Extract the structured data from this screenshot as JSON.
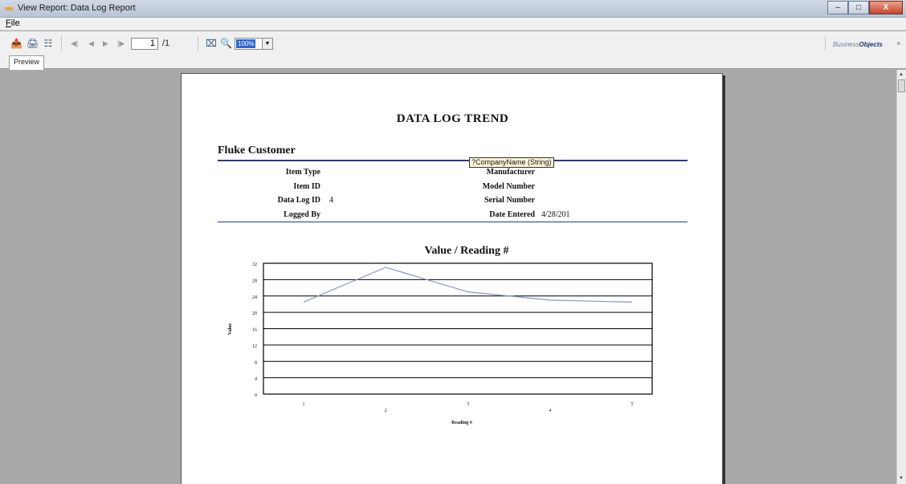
{
  "window": {
    "title": "View Report: Data Log Report",
    "buttons": {
      "minimize": "–",
      "maximize": "□",
      "close": "X"
    }
  },
  "menu": {
    "file": "File"
  },
  "toolbar": {
    "icons": [
      "export-icon",
      "print-icon",
      "group-tree-icon"
    ],
    "nav": [
      "◀|",
      "◀",
      "▶",
      "|▶"
    ],
    "page_current": "1",
    "page_total": "/1",
    "zoom_value": "100%",
    "zoom_arrow": "▼",
    "logo_a": "Business",
    "logo_b": "Objects",
    "close": "×"
  },
  "tabs": {
    "preview": "Preview"
  },
  "report": {
    "title": "DATA LOG TREND",
    "customer": "Fluke Customer",
    "tooltip": "?CompanyName (String)",
    "left_fields": [
      {
        "label": "Item Type",
        "value": ""
      },
      {
        "label": "Item ID",
        "value": ""
      },
      {
        "label": "Data Log ID",
        "value": "4"
      },
      {
        "label": "Logged By",
        "value": ""
      }
    ],
    "right_fields": [
      {
        "label": "Manufacturer",
        "value": ""
      },
      {
        "label": "Model Number",
        "value": ""
      },
      {
        "label": "Serial Number",
        "value": ""
      },
      {
        "label": "Date Entered",
        "value": "4/28/201"
      }
    ]
  },
  "chart_data": {
    "type": "line",
    "title": "Value / Reading #",
    "xlabel": "Reading #",
    "ylabel": "Value",
    "x": [
      1,
      2,
      3,
      4,
      5
    ],
    "y": [
      22.5,
      31,
      25,
      23,
      22.5
    ],
    "ylim": [
      0,
      32
    ],
    "yticks": [
      0,
      4,
      8,
      12,
      16,
      20,
      24,
      28,
      32
    ],
    "line_color": "#8a96c4",
    "grid": true
  }
}
